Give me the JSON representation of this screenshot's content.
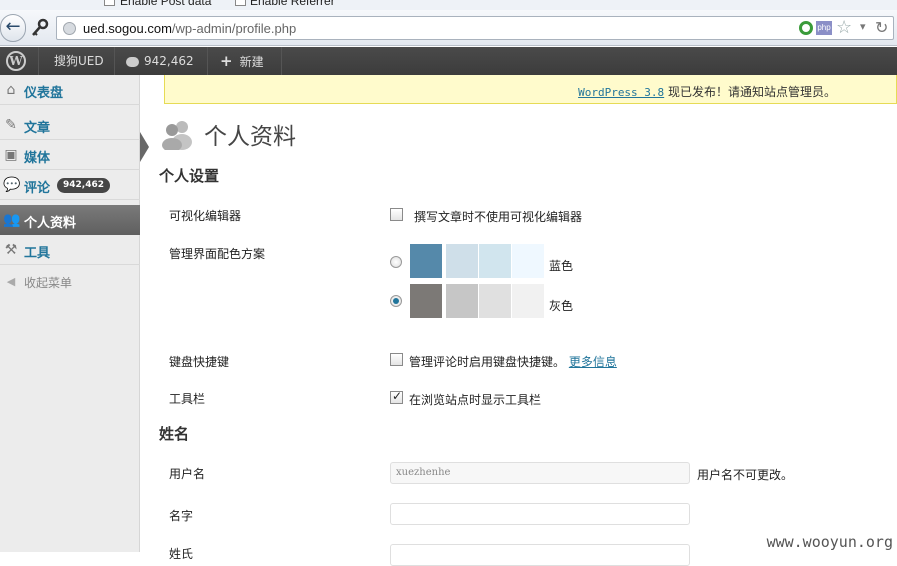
{
  "dev_toolbar": {
    "post_data_label": "Enable Post data",
    "referrer_label": "Enable Referrer"
  },
  "browser": {
    "url_domain": "ued.sogou.com",
    "url_path": "/wp-admin/profile.php",
    "icons": [
      "back-arrow-icon",
      "key-icon",
      "globe-icon",
      "g-icon",
      "php-icon",
      "star-icon",
      "dropdown-icon",
      "reload-icon"
    ]
  },
  "admin_bar": {
    "site_name": "搜狗UED",
    "comments_count": "942,462",
    "new_label": "新建"
  },
  "sidebar": {
    "items": [
      {
        "label": "仪表盘",
        "icon": "dashboard-icon"
      },
      {
        "label": "文章",
        "icon": "pin-icon"
      },
      {
        "label": "媒体",
        "icon": "media-icon"
      },
      {
        "label": "评论",
        "icon": "comment-icon",
        "badge": "942,462"
      },
      {
        "label": "个人资料",
        "icon": "users-icon",
        "current": true
      },
      {
        "label": "工具",
        "icon": "tools-icon"
      },
      {
        "label": "收起菜单",
        "icon": "collapse-icon"
      }
    ]
  },
  "notice": {
    "link": "WordPress 3.8",
    "text": " 现已发布！请通知站点管理员。"
  },
  "page": {
    "title": "个人资料"
  },
  "personal_options": {
    "heading": "个人设置",
    "visual_editor_label": "可视化编辑器",
    "visual_editor_option": "撰写文章时不使用可视化编辑器",
    "color_scheme_label": "管理界面配色方案",
    "schemes": [
      {
        "name": "蓝色",
        "colors": [
          "#5589aa",
          "#cfdfe9",
          "#d1e5ee",
          "#eff8ff"
        ],
        "selected": false
      },
      {
        "name": "灰色",
        "colors": [
          "#7c7976",
          "#c6c6c6",
          "#e0e0e0",
          "#f1f1f1"
        ],
        "selected": true
      }
    ],
    "shortcuts_label": "键盘快捷键",
    "shortcuts_option": "管理评论时启用键盘快捷键。",
    "shortcuts_link": "更多信息",
    "toolbar_label": "工具栏",
    "toolbar_option": "在浏览站点时显示工具栏",
    "toolbar_checked": true
  },
  "name_section": {
    "heading": "姓名",
    "username_label": "用户名",
    "username_value": "xuezhenhe",
    "username_note": "用户名不可更改。",
    "first_name_label": "名字",
    "last_name_label": "姓氏"
  },
  "watermark": "www.wooyun.org"
}
